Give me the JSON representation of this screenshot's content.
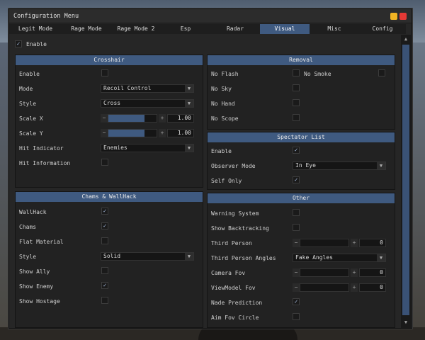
{
  "window": {
    "title": "Configuration Menu"
  },
  "colors": {
    "accent": "#3f5a80",
    "minimize": "#f0b323",
    "close": "#e53935",
    "panel_bg": "#222222"
  },
  "tabs": [
    {
      "label": "Legit Mode",
      "active": false
    },
    {
      "label": "Rage Mode",
      "active": false
    },
    {
      "label": "Rage Mode 2",
      "active": false
    },
    {
      "label": "Esp",
      "active": false
    },
    {
      "label": "Radar",
      "active": false
    },
    {
      "label": "Visual",
      "active": true
    },
    {
      "label": "Misc",
      "active": false
    },
    {
      "label": "Config",
      "active": false
    }
  ],
  "enable": {
    "label": "Enable",
    "checked": true
  },
  "crosshair": {
    "title": "Crosshair",
    "enable": {
      "label": "Enable",
      "checked": false
    },
    "mode": {
      "label": "Mode",
      "value": "Recoil Control"
    },
    "style": {
      "label": "Style",
      "value": "Cross"
    },
    "scale_x": {
      "label": "Scale X",
      "value": "1.00",
      "fraction": 0.75
    },
    "scale_y": {
      "label": "Scale Y",
      "value": "1.00",
      "fraction": 0.75
    },
    "hit_indicator": {
      "label": "Hit Indicator",
      "value": "Enemies"
    },
    "hit_information": {
      "label": "Hit Information",
      "checked": false
    }
  },
  "chams": {
    "title": "Chams & WallHack",
    "wallhack": {
      "label": "WallHack",
      "checked": true
    },
    "chams": {
      "label": "Chams",
      "checked": true
    },
    "flat_material": {
      "label": "Flat Material",
      "checked": false
    },
    "style": {
      "label": "Style",
      "value": "Solid"
    },
    "show_ally": {
      "label": "Show Ally",
      "checked": false
    },
    "show_enemy": {
      "label": "Show Enemy",
      "checked": true
    },
    "show_hostage": {
      "label": "Show Hostage",
      "checked": false
    }
  },
  "removal": {
    "title": "Removal",
    "no_flash": {
      "label": "No Flash",
      "checked": false
    },
    "no_smoke": {
      "label": "No Smoke",
      "checked": false
    },
    "no_sky": {
      "label": "No Sky",
      "checked": false
    },
    "no_hand": {
      "label": "No Hand",
      "checked": false
    },
    "no_scope": {
      "label": "No Scope",
      "checked": false
    }
  },
  "spectator": {
    "title": "Spectator List",
    "enable": {
      "label": "Enable",
      "checked": true
    },
    "observer_mode": {
      "label": "Observer Mode",
      "value": "In Eye"
    },
    "self_only": {
      "label": "Self Only",
      "checked": true
    }
  },
  "other": {
    "title": "Other",
    "warning_system": {
      "label": "Warning System",
      "checked": false
    },
    "show_backtracking": {
      "label": "Show Backtracking",
      "checked": false
    },
    "third_person": {
      "label": "Third Person",
      "value": "0",
      "fraction": 0.0
    },
    "third_person_angles": {
      "label": "Third Person Angles",
      "value": "Fake Angles"
    },
    "camera_fov": {
      "label": "Camera Fov",
      "value": "0",
      "fraction": 0.0
    },
    "viewmodel_fov": {
      "label": "ViewModel Fov",
      "value": "0",
      "fraction": 0.0
    },
    "nade_prediction": {
      "label": "Nade Prediction",
      "checked": true
    },
    "aim_fov_circle": {
      "label": "Aim Fov Circle",
      "checked": false
    }
  }
}
